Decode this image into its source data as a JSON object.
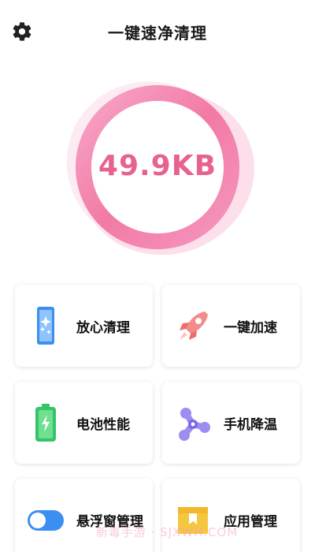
{
  "header": {
    "title": "一键速净清理"
  },
  "meter": {
    "size": "49.9KB"
  },
  "features": [
    {
      "label": "放心清理",
      "icon": "phone-sparkle-icon"
    },
    {
      "label": "一键加速",
      "icon": "rocket-icon"
    },
    {
      "label": "电池性能",
      "icon": "battery-icon"
    },
    {
      "label": "手机降温",
      "icon": "fan-icon"
    },
    {
      "label": "悬浮窗管理",
      "icon": "toggle-icon"
    },
    {
      "label": "应用管理",
      "icon": "app-box-icon"
    }
  ],
  "watermark": "新毒手游 · SJXWH.COM",
  "colors": {
    "accent": "#e7628c",
    "ring": "#f07eaa",
    "glow": "#f9c8df"
  }
}
